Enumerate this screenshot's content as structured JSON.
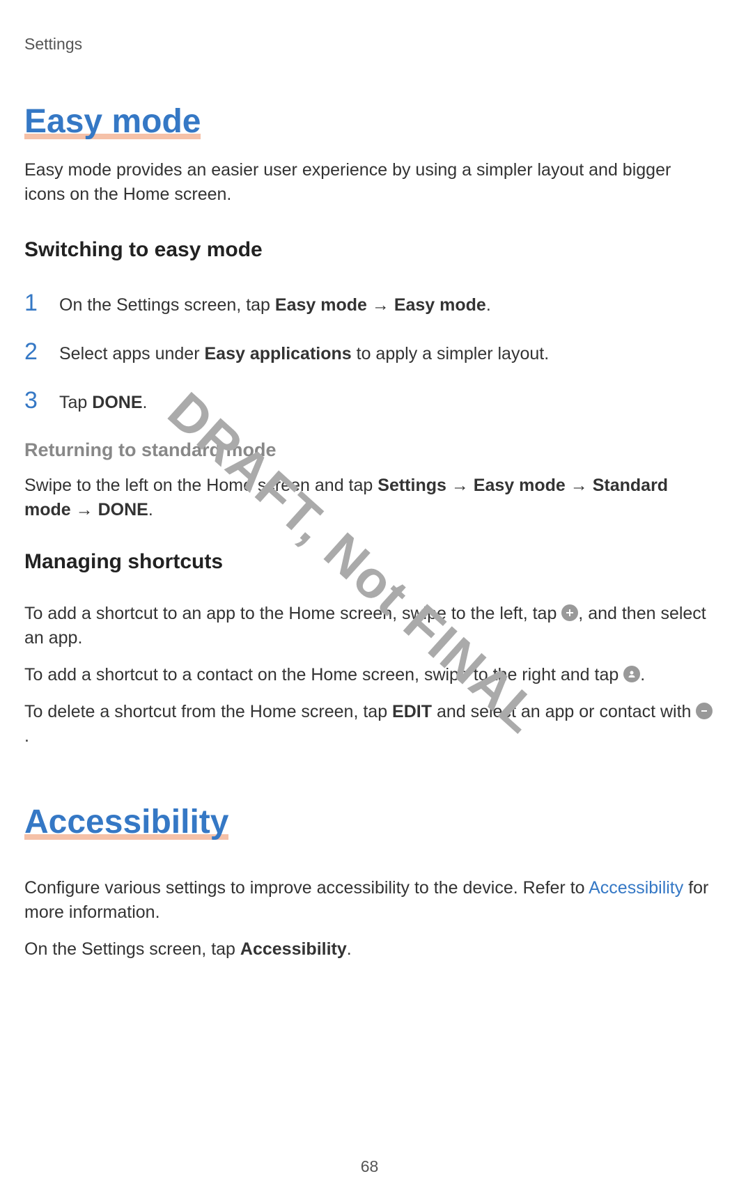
{
  "header": {
    "label": "Settings"
  },
  "sections": {
    "easy_mode": {
      "title": "Easy mode",
      "intro": "Easy mode provides an easier user experience by using a simpler layout and bigger icons on the Home screen.",
      "switching": {
        "heading": "Switching to easy mode",
        "step1_num": "1",
        "step1_prefix": "On the Settings screen, tap ",
        "step1_bold1": "Easy mode",
        "step1_arrow": " → ",
        "step1_bold2": "Easy mode",
        "step1_suffix": ".",
        "step2_num": "2",
        "step2_prefix": "Select apps under ",
        "step2_bold": "Easy applications",
        "step2_suffix": " to apply a simpler layout.",
        "step3_num": "3",
        "step3_prefix": "Tap ",
        "step3_bold": "DONE",
        "step3_suffix": "."
      },
      "returning": {
        "heading": "Returning to standard mode",
        "text_prefix": "Swipe to the left on the Home screen and tap ",
        "bold1": "Settings",
        "arrow1": " → ",
        "bold2": "Easy mode",
        "arrow2": " → ",
        "bold3": "Standard mode",
        "arrow3": " → ",
        "bold4": "DONE",
        "suffix": "."
      },
      "shortcuts": {
        "heading": "Managing shortcuts",
        "para1_prefix": "To add a shortcut to an app to the Home screen, swipe to the left, tap ",
        "para1_suffix": ", and then select an app.",
        "para2_prefix": "To add a shortcut to a contact on the Home screen, swipe to the right and tap ",
        "para2_suffix": ".",
        "para3_prefix": "To delete a shortcut from the Home screen, tap ",
        "para3_bold": "EDIT",
        "para3_mid": " and select an app or contact with ",
        "para3_suffix": "."
      }
    },
    "accessibility": {
      "title": "Accessibility",
      "intro_prefix": "Configure various settings to improve accessibility to the device. Refer to ",
      "intro_link": "Accessibility",
      "intro_suffix": " for more information.",
      "instruction_prefix": "On the Settings screen, tap ",
      "instruction_bold": "Accessibility",
      "instruction_suffix": "."
    }
  },
  "watermark": "DRAFT, Not FINAL",
  "page_number": "68"
}
